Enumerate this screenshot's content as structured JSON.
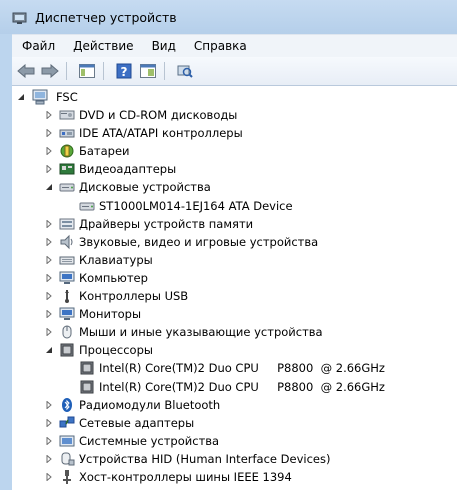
{
  "window": {
    "title": "Диспетчер устройств"
  },
  "menu": [
    "Файл",
    "Действие",
    "Вид",
    "Справка"
  ],
  "toolbar": {
    "buttons": [
      "back-arrow-icon",
      "forward-arrow-icon",
      "console-tree-icon",
      "help-icon",
      "properties-icon",
      "scan-hardware-icon"
    ]
  },
  "tree": {
    "root": {
      "label": "FSC",
      "expanded": true
    },
    "items": [
      {
        "label": "DVD и CD-ROM дисководы",
        "icon": "dvd-drive-icon",
        "level": 1,
        "state": "collapsed"
      },
      {
        "label": "IDE ATA/ATAPI контроллеры",
        "icon": "ide-controller-icon",
        "level": 1,
        "state": "collapsed"
      },
      {
        "label": "Батареи",
        "icon": "battery-icon",
        "level": 1,
        "state": "collapsed"
      },
      {
        "label": "Видеоадаптеры",
        "icon": "display-adapter-icon",
        "level": 1,
        "state": "collapsed"
      },
      {
        "label": "Дисковые устройства",
        "icon": "disk-drive-icon",
        "level": 1,
        "state": "expanded"
      },
      {
        "label": "ST1000LM014-1EJ164 ATA Device",
        "icon": "disk-drive-icon",
        "level": 2,
        "state": "leaf"
      },
      {
        "label": "Драйверы устройств памяти",
        "icon": "storage-driver-icon",
        "level": 1,
        "state": "collapsed"
      },
      {
        "label": "Звуковые, видео и игровые устройства",
        "icon": "speaker-icon",
        "level": 1,
        "state": "collapsed"
      },
      {
        "label": "Клавиатуры",
        "icon": "keyboard-icon",
        "level": 1,
        "state": "collapsed"
      },
      {
        "label": "Компьютер",
        "icon": "computer-icon",
        "level": 1,
        "state": "collapsed"
      },
      {
        "label": "Контроллеры USB",
        "icon": "usb-icon",
        "level": 1,
        "state": "collapsed"
      },
      {
        "label": "Мониторы",
        "icon": "monitor-icon",
        "level": 1,
        "state": "collapsed"
      },
      {
        "label": "Мыши и иные указывающие устройства",
        "icon": "mouse-icon",
        "level": 1,
        "state": "collapsed"
      },
      {
        "label": "Процессоры",
        "icon": "processor-icon",
        "level": 1,
        "state": "expanded"
      },
      {
        "label": "Intel(R) Core(TM)2 Duo CPU     P8800  @ 2.66GHz",
        "icon": "processor-icon",
        "level": 2,
        "state": "leaf"
      },
      {
        "label": "Intel(R) Core(TM)2 Duo CPU     P8800  @ 2.66GHz",
        "icon": "processor-icon",
        "level": 2,
        "state": "leaf"
      },
      {
        "label": "Радиомодули Bluetooth",
        "icon": "bluetooth-icon",
        "level": 1,
        "state": "collapsed"
      },
      {
        "label": "Сетевые адаптеры",
        "icon": "network-adapter-icon",
        "level": 1,
        "state": "collapsed"
      },
      {
        "label": "Системные устройства",
        "icon": "system-devices-icon",
        "level": 1,
        "state": "collapsed"
      },
      {
        "label": "Устройства HID (Human Interface Devices)",
        "icon": "hid-icon",
        "level": 1,
        "state": "collapsed"
      },
      {
        "label": "Хост-контроллеры шины IEEE 1394",
        "icon": "ieee1394-icon",
        "level": 1,
        "state": "collapsed"
      }
    ]
  }
}
